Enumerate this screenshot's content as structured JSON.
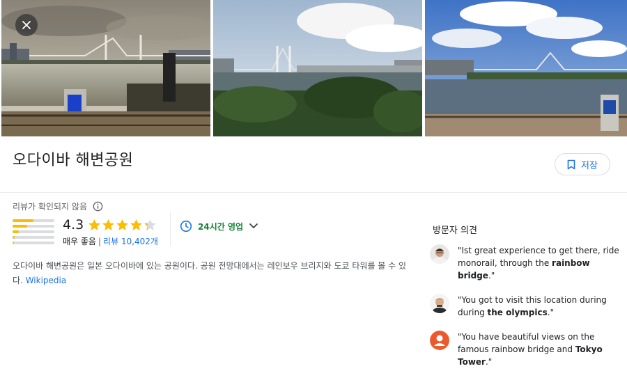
{
  "place": {
    "title": "오다이바 해변공원",
    "save_label": "저장"
  },
  "rating": {
    "unverified_label": "리뷰가 확인되지 않음",
    "score": "4.3",
    "stars_value": 4.3,
    "descriptor": "매우 좋음",
    "separator": "|",
    "reviews_prefix": "리뷰 ",
    "reviews_count": "10,402개",
    "distribution": [
      0.5,
      0.35,
      0.15,
      0.05,
      0.03
    ]
  },
  "hours": {
    "label": "24시간 영업"
  },
  "description": {
    "text": "오다이바 해변공원은 일본 오다이바에 있는 공원이다. 공원 전망대에서는 레인보우 브리지와 도쿄 타워를 볼 수 있다.",
    "source": "Wikipedia"
  },
  "opinions": {
    "title": "방문자 의견",
    "items": [
      {
        "pre": "\"Ist great experience to get there, ride monorail, through the ",
        "bold": "rainbow bridge",
        "post": ".\""
      },
      {
        "pre": "\"You got to visit this location during during ",
        "bold": "the olympics",
        "post": ".\""
      },
      {
        "pre": "\"You have beautiful views on the famous rainbow bridge and ",
        "bold": "Tokyo Tower",
        "post": ".\""
      }
    ]
  },
  "colors": {
    "accent": "#1a73e8",
    "star": "#fbbc04",
    "open": "#188038"
  },
  "icons": {
    "close": "close-icon",
    "bookmark": "bookmark-icon",
    "info": "info-icon",
    "clock": "clock-icon",
    "chevron": "chevron-down-icon"
  }
}
